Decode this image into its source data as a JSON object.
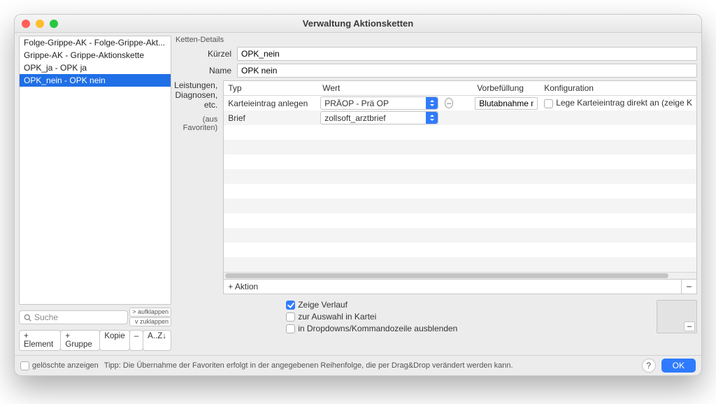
{
  "window": {
    "title": "Verwaltung Aktionsketten"
  },
  "sidebar": {
    "items": [
      "Folge-Grippe-AK - Folge-Grippe-Akt...",
      "Grippe-AK - Grippe-Aktionskette",
      "OPK_ja - OPK ja",
      "OPK_nein - OPK nein"
    ],
    "selected_index": 3,
    "search_placeholder": "Suche",
    "expand": "> aufklappen",
    "collapse": "v zuklappen",
    "btn_element": "+ Element",
    "btn_gruppe": "+ Gruppe",
    "btn_kopie": "Kopie",
    "btn_minus": "–",
    "btn_sort": "A..Z↓"
  },
  "details": {
    "section": "Ketten-Details",
    "label_kuerzel": "Kürzel",
    "value_kuerzel": "OPK_nein",
    "label_name": "Name",
    "value_name": "OPK nein",
    "label_leistungen": "Leistungen,\nDiagnosen,\netc.",
    "label_favoriten": "(aus Favoriten)"
  },
  "table": {
    "headers": {
      "typ": "Typ",
      "wert": "Wert",
      "vorbef": "Vorbefüllung",
      "konfig": "Konfiguration"
    },
    "rows": [
      {
        "typ": "Karteieintrag anlegen",
        "wert": "PRÄOP - Prä OP",
        "vorbef": "Blutabnahme n",
        "konfig": "Lege Karteieintrag direkt an (zeige K",
        "has_minus": true,
        "has_chk": true,
        "has_drop": true
      },
      {
        "typ": "Brief",
        "wert": "zollsoft_arztbrief",
        "vorbef": "",
        "konfig": "",
        "has_minus": false,
        "has_chk": false,
        "has_drop": true
      }
    ],
    "add_action": "+ Aktion"
  },
  "checks": {
    "zeige_verlauf": "Zeige Verlauf",
    "zur_auswahl": "zur Auswahl in Kartei",
    "ausblenden": "in Dropdowns/Kommandozeile ausblenden"
  },
  "footer": {
    "geloeschte": "gelöschte anzeigen",
    "tip": "Tipp: Die Übernahme der Favoriten erfolgt in der angegebenen Reihenfolge, die per Drag&Drop verändert werden kann.",
    "ok": "OK"
  }
}
